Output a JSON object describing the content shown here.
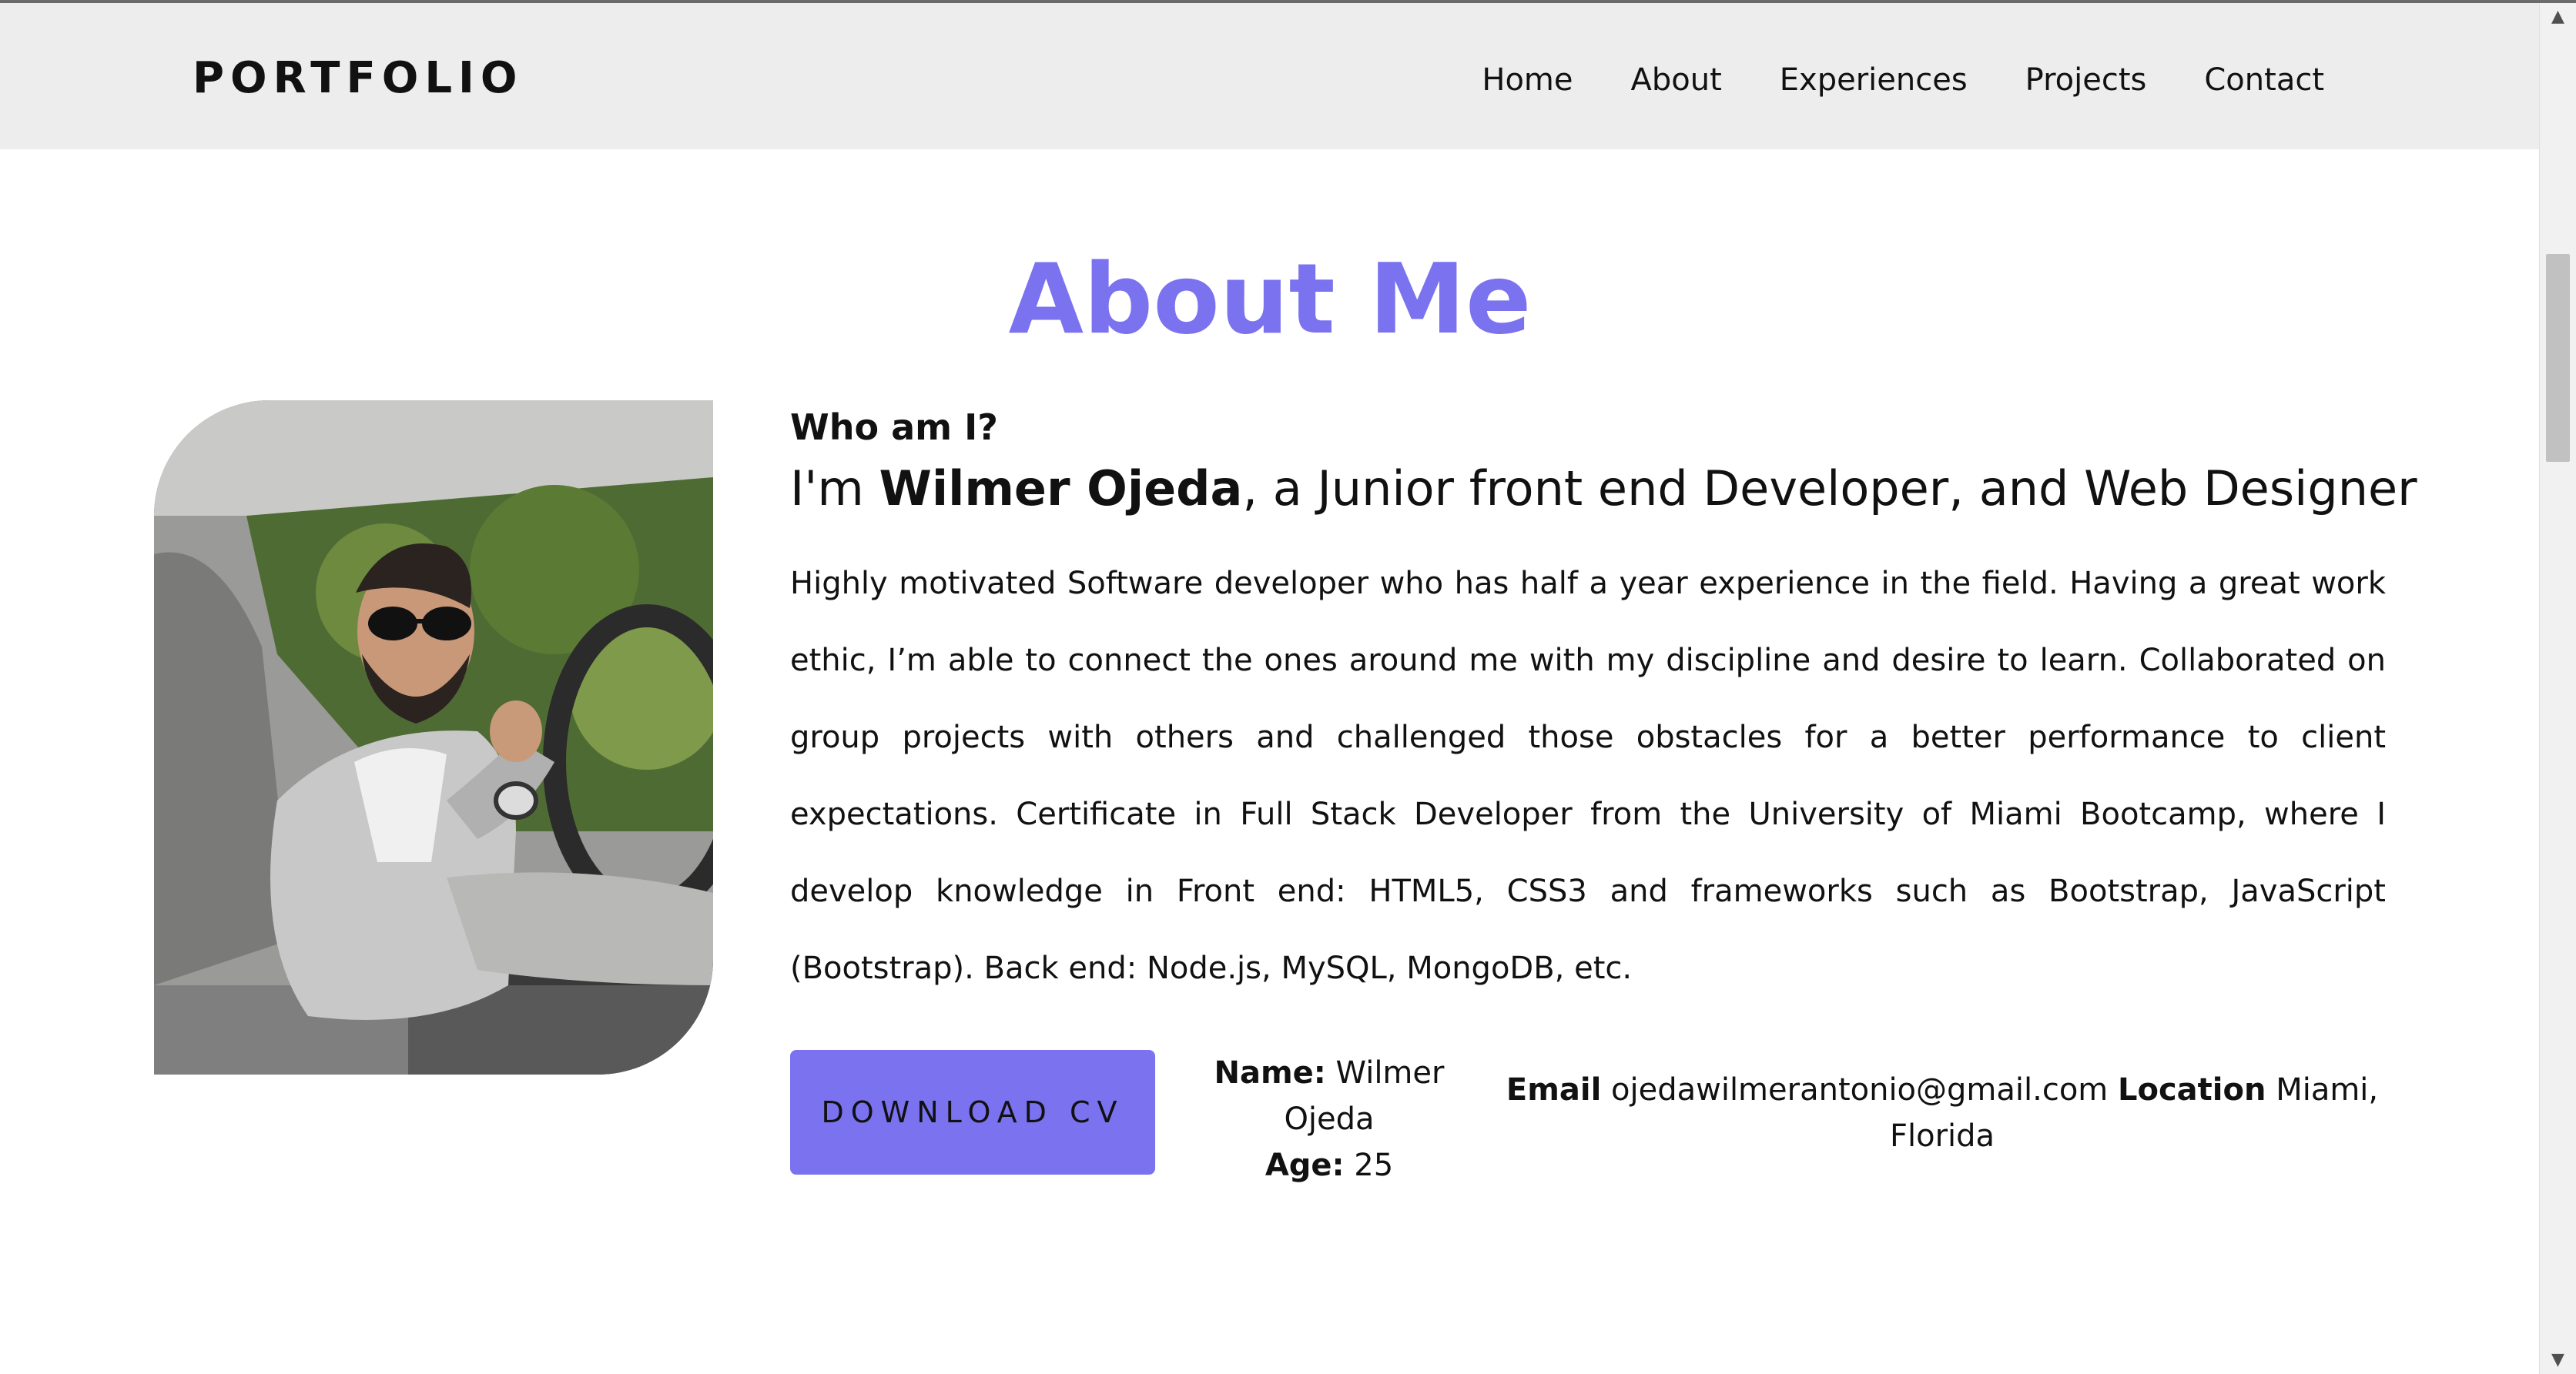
{
  "header": {
    "brand": "PORTFOLIO",
    "nav": [
      "Home",
      "About",
      "Experiences",
      "Projects",
      "Contact"
    ]
  },
  "about": {
    "title": "About Me",
    "who_heading": "Who am I?",
    "intro_prefix": "I'm ",
    "name": "Wilmer Ojeda",
    "intro_suffix": ", a Junior front end Developer, and Web Designer",
    "bio": "Highly motivated Software developer who has half a year experience in the field. Having a great work ethic, I’m able to connect the ones around me with my discipline and desire to learn. Collaborated on group projects with others and challenged those obstacles for a better performance to client expectations. Certificate in Full Stack Developer from the University of Miami Bootcamp, where I develop knowledge in Front end: HTML5, CSS3 and frameworks such as Bootstrap, JavaScript (Bootstrap). Back end: Node.js, MySQL, MongoDB, etc.",
    "download_label": "DOWNLOAD CV",
    "name_label": "Name:",
    "name_value": "Wilmer Ojeda",
    "age_label": "Age:",
    "age_value": "25",
    "email_label": "Email",
    "email_value": "ojedawilmerantonio@gmail.com",
    "location_label": "Location",
    "location_value": "Miami, Florida"
  },
  "icons": {
    "scroll_up": "triangle-up-icon",
    "scroll_down": "triangle-down-icon"
  },
  "colors": {
    "accent": "#7a72ef",
    "header_bg": "#ededed"
  }
}
